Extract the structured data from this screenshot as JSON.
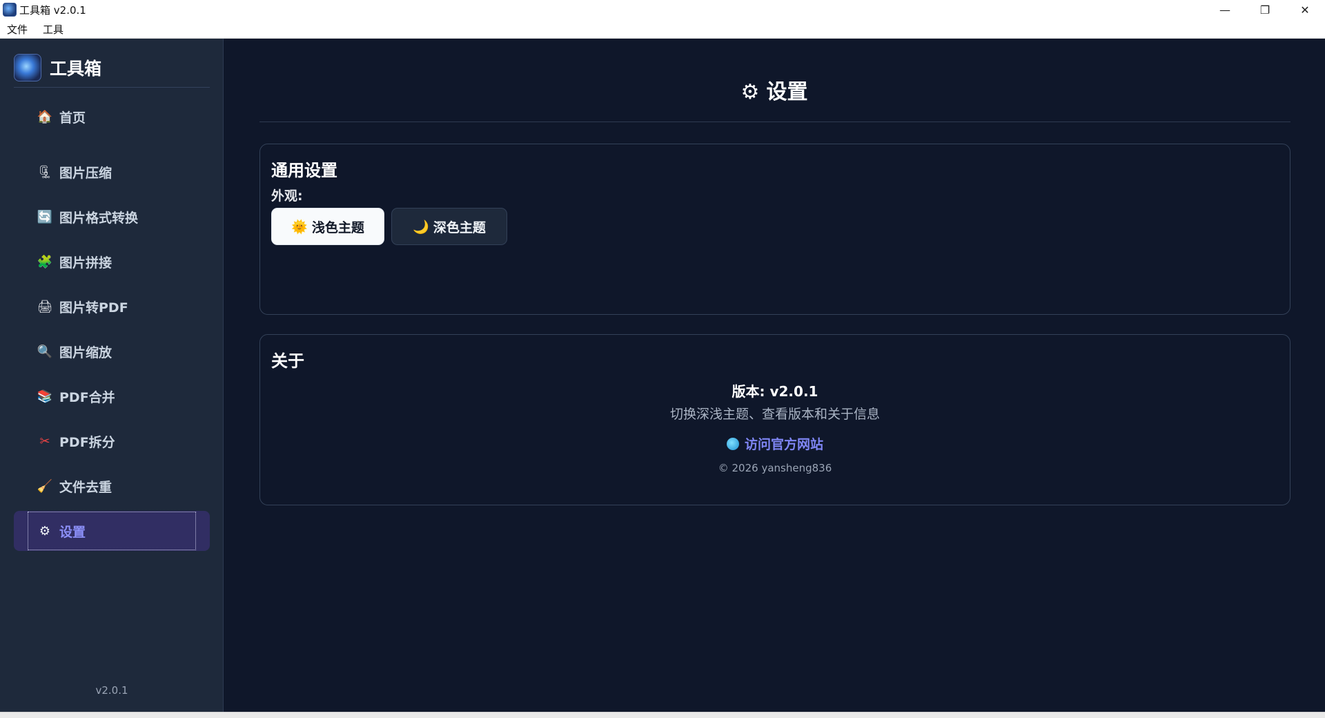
{
  "window": {
    "title": "工具箱 v2.0.1",
    "menu": [
      "文件",
      "工具"
    ],
    "controls": {
      "minimize": "—",
      "maximize": "❐",
      "close": "✕"
    }
  },
  "sidebar": {
    "brand": "工具箱",
    "items": [
      {
        "label": "首页",
        "icon": "🏠",
        "icon_name": "home-icon"
      },
      {
        "label": "图片压缩",
        "icon": "🗜",
        "icon_name": "compress-icon"
      },
      {
        "label": "图片格式转换",
        "icon": "🔄",
        "icon_name": "convert-icon"
      },
      {
        "label": "图片拼接",
        "icon": "🧩",
        "icon_name": "puzzle-icon"
      },
      {
        "label": "图片转PDF",
        "icon": "🖨",
        "icon_name": "printer-icon"
      },
      {
        "label": "图片缩放",
        "icon": "🔍",
        "icon_name": "magnifier-icon"
      },
      {
        "label": "PDF合并",
        "icon": "📚",
        "icon_name": "books-icon"
      },
      {
        "label": "PDF拆分",
        "icon": "✂",
        "icon_name": "scissors-icon"
      },
      {
        "label": "文件去重",
        "icon": "🧹",
        "icon_name": "broom-icon"
      },
      {
        "label": "设置",
        "icon": "⚙",
        "icon_name": "gear-icon",
        "active": true
      }
    ],
    "version": "v2.0.1"
  },
  "main": {
    "title": "设置",
    "title_icon": "⚙",
    "general": {
      "title": "通用设置",
      "appearance_label": "外观:",
      "light_theme": {
        "icon": "🌞",
        "label": "浅色主题"
      },
      "dark_theme": {
        "icon": "🌙",
        "label": "深色主题"
      }
    },
    "about": {
      "title": "关于",
      "version": "版本: v2.0.1",
      "description": "切换深浅主题、查看版本和关于信息",
      "link": "访问官方网站",
      "copyright": "© 2026 yansheng836"
    }
  },
  "colors": {
    "background": "#0f172a",
    "sidebar": "#1e293b",
    "accent": "#7f86f5",
    "active_item": "#312e63"
  }
}
